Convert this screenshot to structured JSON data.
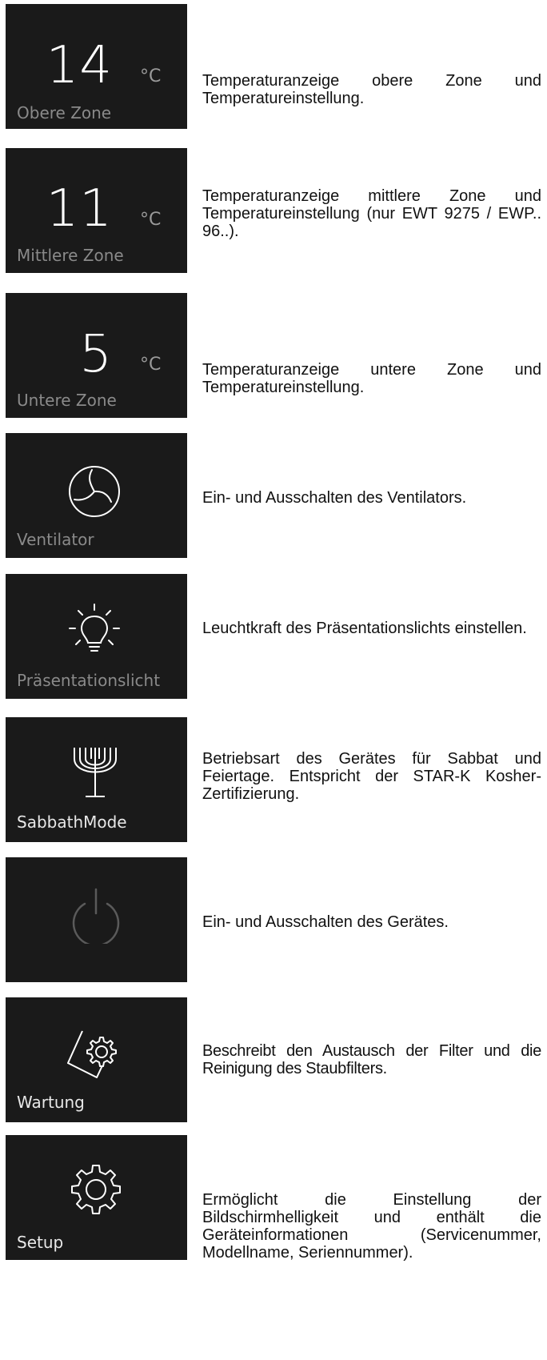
{
  "rows": [
    {
      "value": "14",
      "unit": "°C",
      "label": "Obere Zone",
      "description": "Temperaturanzeige obere Zone und Temperatureinstellung."
    },
    {
      "value": "11",
      "unit": "°C",
      "label": "Mittlere Zone",
      "description": "Temperaturanzeige mittlere Zone und Temperatureinstellung (nur EWT 9275 / EWP.. 96..)."
    },
    {
      "value": "5",
      "unit": "°C",
      "label": "Untere Zone",
      "description": "Temperaturanzeige untere Zone und Temperatureinstellung."
    },
    {
      "icon": "fan-icon",
      "label": "Ventilator",
      "description": "Ein- und Ausschalten des Ventilators."
    },
    {
      "icon": "light-bulb-icon",
      "label": "Präsentationslicht",
      "description": "Leuchtkraft des Präsentationslichts einstellen."
    },
    {
      "icon": "menorah-icon",
      "label": "SabbathMode",
      "description": "Betriebsart des Gerätes für Sabbat und Feiertage. Entspricht der STAR-K Kosher-Zertifizierung."
    },
    {
      "icon": "power-icon",
      "label": "",
      "description": "Ein- und Ausschalten des Gerätes."
    },
    {
      "icon": "maintenance-gear-icon",
      "label": "Wartung",
      "description": "Beschreibt den Austausch der Filter und die Reinigung des Staubfilters."
    },
    {
      "icon": "settings-gear-icon",
      "label": "Setup",
      "description": "Ermöglicht die Einstellung der Bildschirmhelligkeit und enthält die Geräteinformationen (Servicenummer, Modellname, Seriennummer)."
    }
  ]
}
